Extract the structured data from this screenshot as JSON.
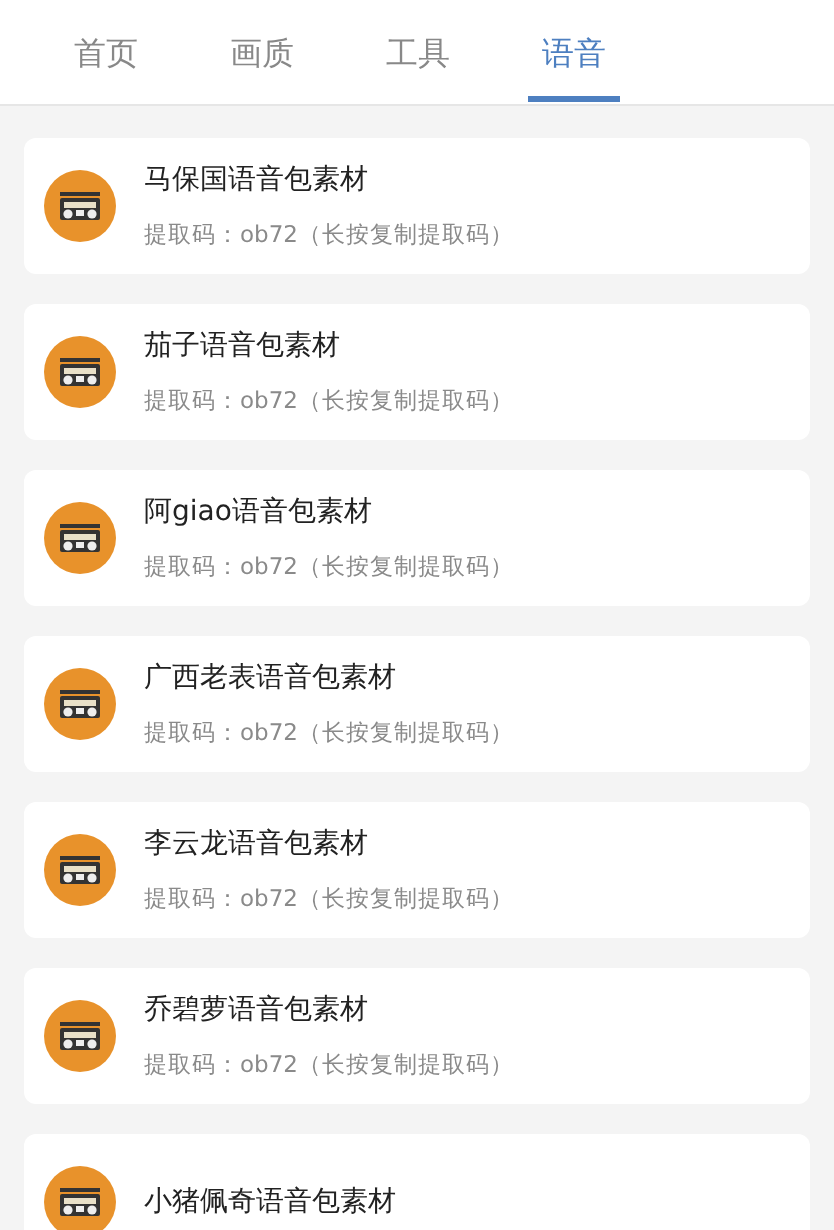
{
  "tabs": [
    {
      "label": "首页",
      "selected": false
    },
    {
      "label": "画质",
      "selected": false
    },
    {
      "label": "工具",
      "selected": false
    },
    {
      "label": "语音",
      "selected": true
    }
  ],
  "items": [
    {
      "title": "马保国语音包素材",
      "code": "提取码：ob72（长按复制提取码）"
    },
    {
      "title": "茄子语音包素材",
      "code": "提取码：ob72（长按复制提取码）"
    },
    {
      "title": "阿giao语音包素材",
      "code": "提取码：ob72（长按复制提取码）"
    },
    {
      "title": "广西老表语音包素材",
      "code": "提取码：ob72（长按复制提取码）"
    },
    {
      "title": "李云龙语音包素材",
      "code": "提取码：ob72（长按复制提取码）"
    },
    {
      "title": "乔碧萝语音包素材",
      "code": "提取码：ob72（长按复制提取码）"
    },
    {
      "title": "小猪佩奇语音包素材"
    }
  ]
}
